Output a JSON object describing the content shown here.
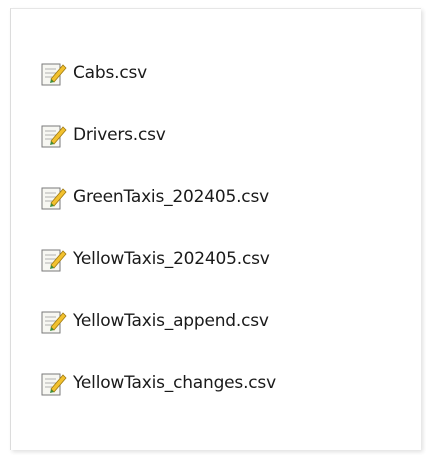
{
  "files": [
    {
      "name": "Cabs.csv",
      "icon": "notepad-file-icon"
    },
    {
      "name": "Drivers.csv",
      "icon": "notepad-file-icon"
    },
    {
      "name": "GreenTaxis_202405.csv",
      "icon": "notepad-file-icon"
    },
    {
      "name": "YellowTaxis_202405.csv",
      "icon": "notepad-file-icon"
    },
    {
      "name": "YellowTaxis_append.csv",
      "icon": "notepad-file-icon"
    },
    {
      "name": "YellowTaxis_changes.csv",
      "icon": "notepad-file-icon"
    }
  ],
  "colors": {
    "icon_paper": "#f7f7f2",
    "icon_border": "#7a7a7a",
    "icon_lines": "#b0b0b0",
    "pencil_body": "#f2c12e",
    "pencil_tip": "#3d8f3a"
  }
}
